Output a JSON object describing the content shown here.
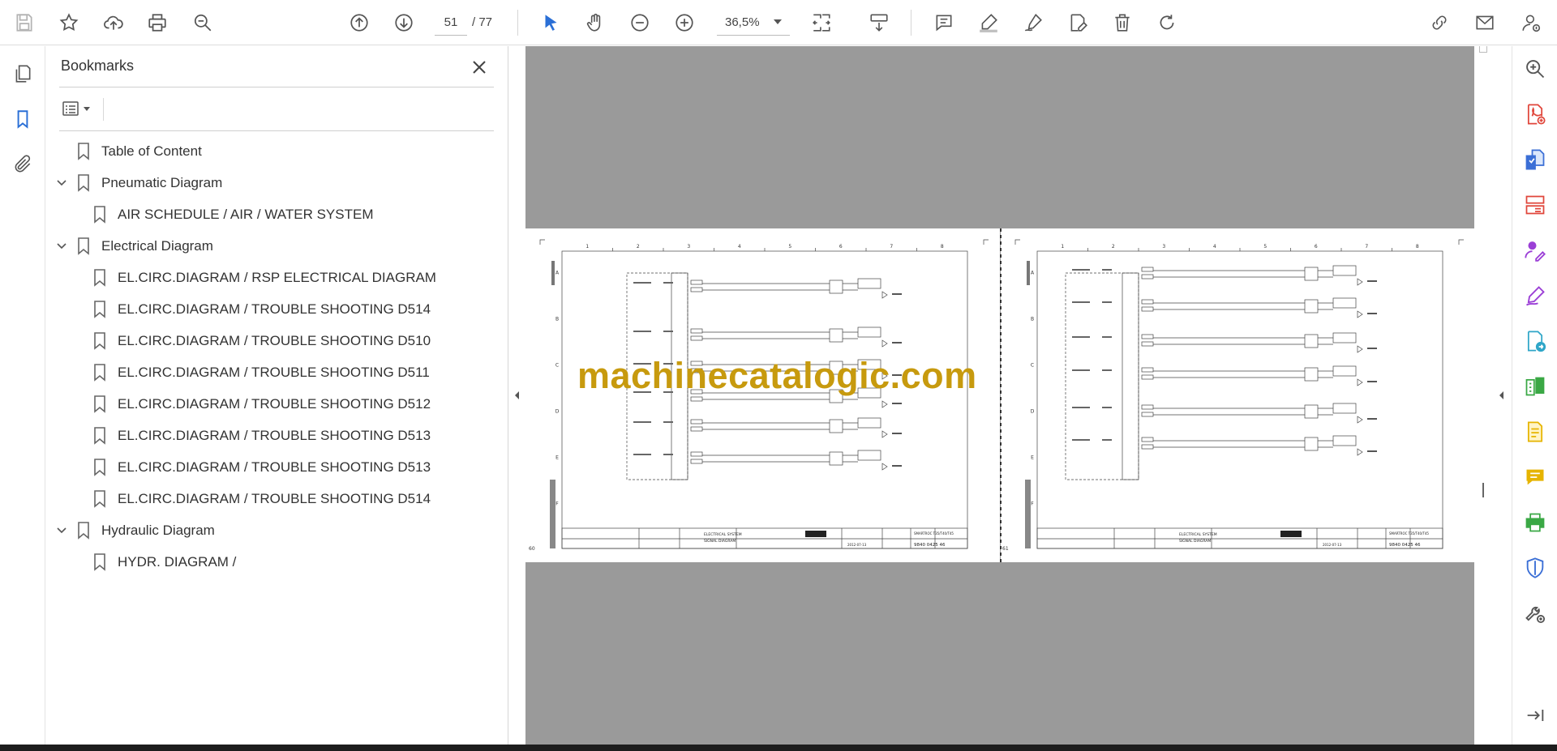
{
  "toolbar": {
    "current_page": "51",
    "total_pages": "/  77",
    "zoom": "36,5%",
    "icons": [
      "save-icon",
      "bookmark-star-icon",
      "upload-icon",
      "print-icon",
      "find-zoom-icon",
      "page-up-icon",
      "page-down-icon",
      "select-cursor-icon",
      "hand-icon",
      "zoom-out-icon",
      "zoom-in-icon",
      "fit-page-icon",
      "scroll-mode-icon",
      "comment-icon",
      "highlight-icon",
      "sign-icon",
      "edit-icon",
      "delete-icon",
      "rotate-icon",
      "share-link-icon",
      "email-icon",
      "account-icon"
    ],
    "accent": "#2a6fd6"
  },
  "left_rail": {
    "icons": [
      "thumbnails-icon",
      "bookmarks-icon",
      "attachments-icon"
    ]
  },
  "bookmarks": {
    "title": "Bookmarks",
    "items": [
      {
        "label": "Table of Content",
        "level": 0,
        "expander": false
      },
      {
        "label": "Pneumatic Diagram",
        "level": 0,
        "expander": true
      },
      {
        "label": "AIR SCHEDULE / AIR / WATER SYSTEM",
        "level": 1,
        "expander": false
      },
      {
        "label": "Electrical Diagram",
        "level": 0,
        "expander": true
      },
      {
        "label": "EL.CIRC.DIAGRAM / RSP ELECTRICAL DIAGRAM",
        "level": 1,
        "expander": false
      },
      {
        "label": "EL.CIRC.DIAGRAM / TROUBLE SHOOTING D514",
        "level": 1,
        "expander": false
      },
      {
        "label": "EL.CIRC.DIAGRAM / TROUBLE SHOOTING D510",
        "level": 1,
        "expander": false
      },
      {
        "label": "EL.CIRC.DIAGRAM / TROUBLE SHOOTING D511",
        "level": 1,
        "expander": false
      },
      {
        "label": "EL.CIRC.DIAGRAM / TROUBLE SHOOTING D512",
        "level": 1,
        "expander": false
      },
      {
        "label": "EL.CIRC.DIAGRAM / TROUBLE SHOOTING D513",
        "level": 1,
        "expander": false
      },
      {
        "label": "EL.CIRC.DIAGRAM / TROUBLE SHOOTING D513",
        "level": 1,
        "expander": false
      },
      {
        "label": "EL.CIRC.DIAGRAM / TROUBLE SHOOTING D514",
        "level": 1,
        "expander": false
      },
      {
        "label": "Hydraulic Diagram",
        "level": 0,
        "expander": true
      },
      {
        "label": "HYDR. DIAGRAM /",
        "level": 1,
        "expander": false
      }
    ]
  },
  "document": {
    "watermark": "machinecatalogic.com",
    "left_page": {
      "number": "60",
      "column_labels": [
        "1",
        "2",
        "3",
        "4",
        "5",
        "6",
        "7",
        "8"
      ],
      "row_labels": [
        "A",
        "B",
        "C",
        "D",
        "E",
        "F"
      ],
      "title_block": {
        "system": "ELECTRICAL SYSTEM",
        "diagram": "SIGNAL DIAGRAM",
        "date": "2012-07-13",
        "code": "9840 0425 46",
        "model": "SMARTROC T35/T40/T45"
      }
    },
    "right_page": {
      "number": "61",
      "column_labels": [
        "1",
        "2",
        "3",
        "4",
        "5",
        "6",
        "7",
        "8"
      ],
      "row_labels": [
        "A",
        "B",
        "C",
        "D",
        "E",
        "F"
      ],
      "title_block": {
        "system": "ELECTRICAL SYSTEM",
        "diagram": "SIGNAL DIAGRAM",
        "date": "2012-07-13",
        "code": "9840 0425 46",
        "model": "SMARTROC T35/T40/T45"
      }
    },
    "background": "#9a9a9a"
  },
  "right_rail": {
    "icons": [
      {
        "name": "zoom-search-icon",
        "color": "#555555"
      },
      {
        "name": "export-pdf-icon",
        "color": "#e0463b"
      },
      {
        "name": "create-pdf-icon",
        "color": "#3b6fd6"
      },
      {
        "name": "organize-pages-icon",
        "color": "#e0463b"
      },
      {
        "name": "request-signature-icon",
        "color": "#9b3fd6"
      },
      {
        "name": "fill-sign-icon",
        "color": "#9b3fd6"
      },
      {
        "name": "send-file-icon",
        "color": "#2fa6c8"
      },
      {
        "name": "compare-files-icon",
        "color": "#3aa845"
      },
      {
        "name": "scan-ocr-icon",
        "color": "#e6b400"
      },
      {
        "name": "comment-tool-icon",
        "color": "#e6b400"
      },
      {
        "name": "print-production-icon",
        "color": "#3aa845"
      },
      {
        "name": "protect-icon",
        "color": "#3b6fd6"
      },
      {
        "name": "more-tools-icon",
        "color": "#555555"
      }
    ],
    "expand_icon": "expand-panel-icon"
  }
}
